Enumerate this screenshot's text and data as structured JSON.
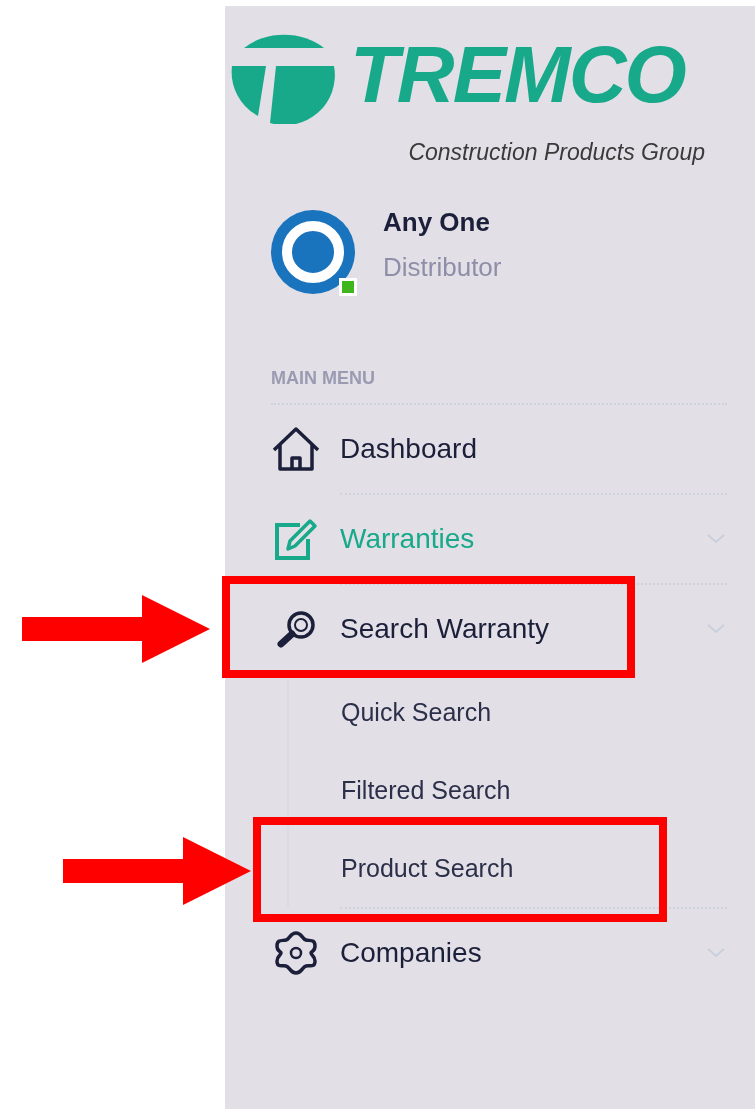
{
  "logo": {
    "name": "TREMCO",
    "tagline": "Construction Products Group"
  },
  "user": {
    "name": "Any One",
    "role": "Distributor",
    "online": true
  },
  "menu": {
    "header": "MAIN MENU",
    "items": [
      {
        "label": "Dashboard",
        "selected": false,
        "expandable": false,
        "annotated": false
      },
      {
        "label": "Warranties",
        "selected": true,
        "expandable": true,
        "annotated": false
      },
      {
        "label": "Search Warranty",
        "selected": false,
        "expandable": true,
        "annotated": true,
        "children": [
          {
            "label": "Quick Search",
            "annotated": false
          },
          {
            "label": "Filtered Search",
            "annotated": false
          },
          {
            "label": "Product Search",
            "annotated": true
          }
        ]
      },
      {
        "label": "Companies",
        "selected": false,
        "expandable": true,
        "annotated": false
      }
    ]
  }
}
